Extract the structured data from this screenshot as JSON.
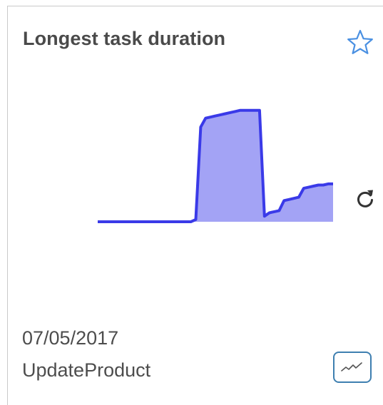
{
  "card": {
    "title": "Longest task duration",
    "date": "07/05/2017",
    "task_name": "UpdateProduct"
  },
  "icons": {
    "favorite": "star-outline-icon",
    "refresh": "refresh-icon",
    "trend": "trend-line-icon"
  },
  "colors": {
    "line": "#3a3ae8",
    "fill": "#a3a3f5",
    "star": "#4a90e2",
    "trend_button_border": "#3e7fb0"
  },
  "chart_data": {
    "type": "area",
    "x": [
      0,
      1,
      2,
      3,
      4,
      5,
      6,
      7,
      8,
      9,
      10,
      11,
      12,
      13,
      14,
      15,
      16,
      17,
      18,
      19,
      20,
      21,
      22,
      23,
      24,
      25,
      26,
      27,
      28,
      29,
      30,
      31,
      32,
      33,
      34,
      35,
      36,
      37,
      38,
      39,
      40,
      41,
      42,
      43,
      44,
      45,
      46,
      47,
      48
    ],
    "y": [
      0,
      0,
      0,
      0,
      0,
      0,
      0,
      0,
      0,
      0,
      0,
      0,
      0,
      0,
      0,
      0,
      0,
      0,
      0,
      0,
      0.02,
      0.85,
      0.93,
      0.94,
      0.95,
      0.96,
      0.97,
      0.98,
      0.99,
      1.0,
      1.0,
      1.0,
      1.0,
      1.0,
      0.05,
      0.08,
      0.09,
      0.1,
      0.19,
      0.2,
      0.21,
      0.22,
      0.3,
      0.31,
      0.32,
      0.33,
      0.33,
      0.34,
      0.34
    ],
    "ylim": [
      0,
      1.05
    ],
    "axes_visible": false,
    "grid": false
  }
}
